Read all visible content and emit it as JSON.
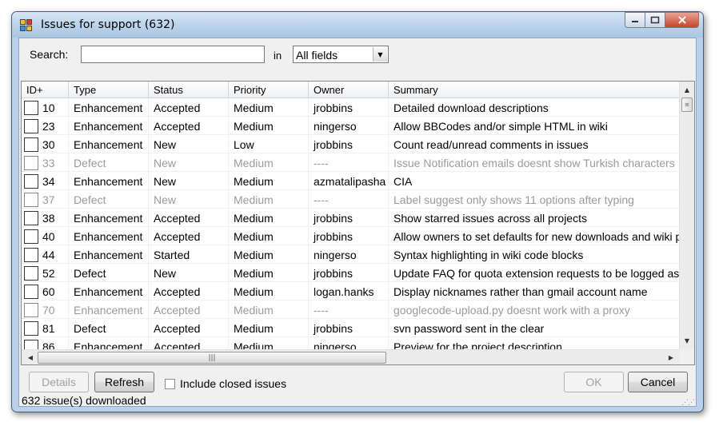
{
  "window": {
    "title": "Issues for support (632)",
    "colors": {
      "titlebar": "#bcd4ec",
      "close": "#c4452e"
    }
  },
  "search": {
    "label": "Search:",
    "value": "",
    "in_label": "in",
    "field_selected": "All fields"
  },
  "grid": {
    "columns": [
      "ID+",
      "Type",
      "Status",
      "Priority",
      "Owner",
      "Summary"
    ],
    "rows": [
      {
        "id": "10",
        "type": "Enhancement",
        "status": "Accepted",
        "priority": "Medium",
        "owner": "jrobbins",
        "summary": "Detailed download descriptions",
        "closed": false
      },
      {
        "id": "23",
        "type": "Enhancement",
        "status": "Accepted",
        "priority": "Medium",
        "owner": "ningerso",
        "summary": "Allow BBCodes and/or simple HTML in wiki",
        "closed": false
      },
      {
        "id": "30",
        "type": "Enhancement",
        "status": "New",
        "priority": "Low",
        "owner": "jrobbins",
        "summary": "Count read/unread comments in issues",
        "closed": false
      },
      {
        "id": "33",
        "type": "Defect",
        "status": "New",
        "priority": "Medium",
        "owner": "----",
        "summary": "Issue Notification emails doesnt show Turkish characters",
        "closed": true
      },
      {
        "id": "34",
        "type": "Enhancement",
        "status": "New",
        "priority": "Medium",
        "owner": "azmatalipasha",
        "summary": "CIA",
        "closed": false
      },
      {
        "id": "37",
        "type": "Defect",
        "status": "New",
        "priority": "Medium",
        "owner": "----",
        "summary": "Label suggest only shows 11 options after typing",
        "closed": true
      },
      {
        "id": "38",
        "type": "Enhancement",
        "status": "Accepted",
        "priority": "Medium",
        "owner": "jrobbins",
        "summary": "Show starred issues across all projects",
        "closed": false
      },
      {
        "id": "40",
        "type": "Enhancement",
        "status": "Accepted",
        "priority": "Medium",
        "owner": "jrobbins",
        "summary": "Allow owners to set defaults for new downloads and wiki pag",
        "closed": false
      },
      {
        "id": "44",
        "type": "Enhancement",
        "status": "Started",
        "priority": "Medium",
        "owner": "ningerso",
        "summary": "Syntax highlighting in wiki code blocks",
        "closed": false
      },
      {
        "id": "52",
        "type": "Defect",
        "status": "New",
        "priority": "Medium",
        "owner": "jrobbins",
        "summary": "Update FAQ for quota extension requests to be logged as ar",
        "closed": false
      },
      {
        "id": "60",
        "type": "Enhancement",
        "status": "Accepted",
        "priority": "Medium",
        "owner": "logan.hanks",
        "summary": "Display nicknames rather than gmail account name",
        "closed": false
      },
      {
        "id": "70",
        "type": "Enhancement",
        "status": "Accepted",
        "priority": "Medium",
        "owner": "----",
        "summary": "googlecode-upload.py doesnt work with a proxy",
        "closed": true
      },
      {
        "id": "81",
        "type": "Defect",
        "status": "Accepted",
        "priority": "Medium",
        "owner": "jrobbins",
        "summary": "svn password sent in the clear",
        "closed": false
      },
      {
        "id": "86",
        "type": "Enhancement",
        "status": "Accepted",
        "priority": "Medium",
        "owner": "ningerso",
        "summary": "Preview for the project description",
        "closed": false
      }
    ]
  },
  "buttons": {
    "details": "Details",
    "refresh": "Refresh",
    "ok": "OK",
    "cancel": "Cancel"
  },
  "include_closed": {
    "label": "Include closed issues",
    "checked": false
  },
  "status": "632 issue(s) downloaded"
}
